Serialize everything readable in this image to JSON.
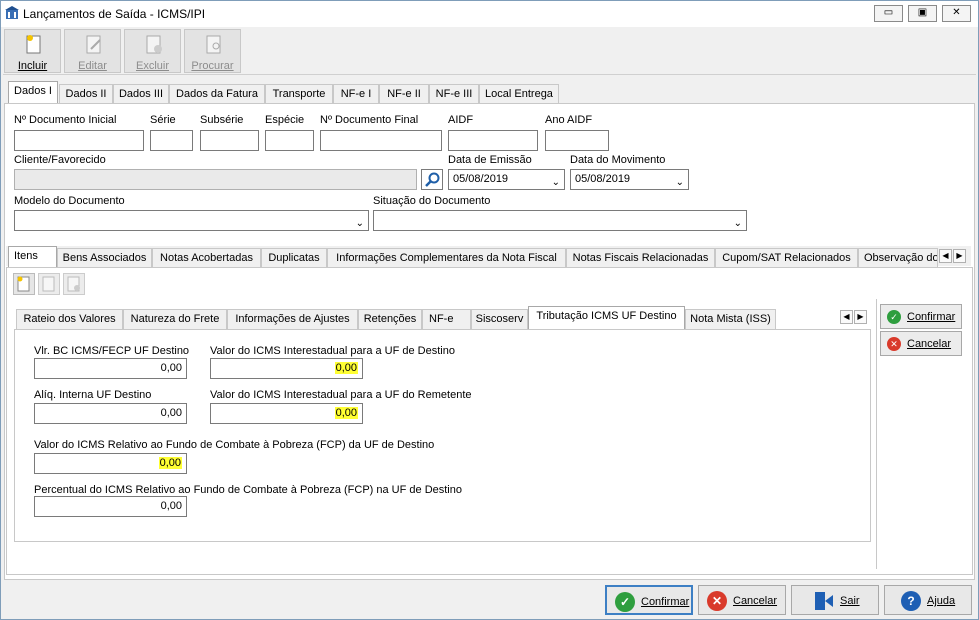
{
  "window": {
    "title": "Lançamentos de Saída - ICMS/IPI",
    "controls": [
      "▭",
      "▣",
      "✕"
    ]
  },
  "toolbar": {
    "buttons": [
      {
        "label": "Incluir",
        "icon": "new-document-icon"
      },
      {
        "label": "Editar",
        "icon": "edit-document-icon"
      },
      {
        "label": "Excluir",
        "icon": "delete-document-icon"
      },
      {
        "label": "Procurar",
        "icon": "search-document-icon"
      }
    ]
  },
  "main_tabs": [
    "Dados I",
    "Dados II",
    "Dados III",
    "Dados da Fatura",
    "Transporte",
    "NF-e I",
    "NF-e II",
    "NF-e III",
    "Local Entrega"
  ],
  "header_form": {
    "doc_inicial": {
      "label": "Nº Documento Inicial",
      "value": ""
    },
    "serie": {
      "label": "Série",
      "value": ""
    },
    "subserie": {
      "label": "Subsérie",
      "value": ""
    },
    "especie": {
      "label": "Espécie",
      "value": ""
    },
    "doc_final": {
      "label": "Nº Documento Final",
      "value": ""
    },
    "aidf": {
      "label": "AIDF",
      "value": ""
    },
    "ano_aidf": {
      "label": "Ano AIDF",
      "value": ""
    },
    "cliente": {
      "label": "Cliente/Favorecido",
      "value": ""
    },
    "data_emissao": {
      "label": "Data de Emissão",
      "value": "05/08/2019"
    },
    "data_movimento": {
      "label": "Data do Movimento",
      "value": "05/08/2019"
    },
    "modelo": {
      "label": "Modelo do Documento",
      "value": ""
    },
    "situacao": {
      "label": "Situação do Documento",
      "value": ""
    }
  },
  "sub_tabs": [
    "Itens",
    "Bens Associados",
    "Notas Acobertadas",
    "Duplicatas",
    "Informações Complementares da Nota Fiscal",
    "Notas Fiscais Relacionadas",
    "Cupom/SAT Relacionados",
    "Observação do"
  ],
  "item_tabs": [
    "Rateio dos Valores",
    "Natureza do Frete",
    "Informações de Ajustes",
    "Retenções",
    "NF-e",
    "Siscoserv",
    "Tributação ICMS UF Destino",
    "Nota Mista (ISS)"
  ],
  "icms_fields": {
    "vlr_bc": {
      "label": "Vlr. BC ICMS/FECP UF Destino",
      "value": "0,00"
    },
    "icms_dest": {
      "label": "Valor do ICMS Interestadual para a UF de Destino",
      "value": "0,00"
    },
    "aliq_interna": {
      "label": "Alíq. Interna UF Destino",
      "value": "0,00"
    },
    "icms_remet": {
      "label": "Valor do ICMS Interestadual para a UF do Remetente",
      "value": "0,00"
    },
    "fcp_valor": {
      "label": "Valor do ICMS Relativo ao Fundo de Combate à Pobreza (FCP) da UF de Destino",
      "value": "0,00"
    },
    "fcp_perc": {
      "label": "Percentual do ICMS Relativo ao Fundo de Combate à Pobreza (FCP) na UF de Destino",
      "value": "0,00"
    }
  },
  "side_buttons": {
    "confirmar": "Confirmar",
    "cancelar": "Cancelar"
  },
  "bottom_buttons": {
    "confirmar": "Confirmar",
    "cancelar": "Cancelar",
    "sair": "Sair",
    "ajuda": "Ajuda"
  },
  "colors": {
    "highlight": "#ffff33",
    "confirm_green": "#2e9e3e",
    "cancel_red": "#d93a2b",
    "help_blue": "#1e5fb4"
  }
}
